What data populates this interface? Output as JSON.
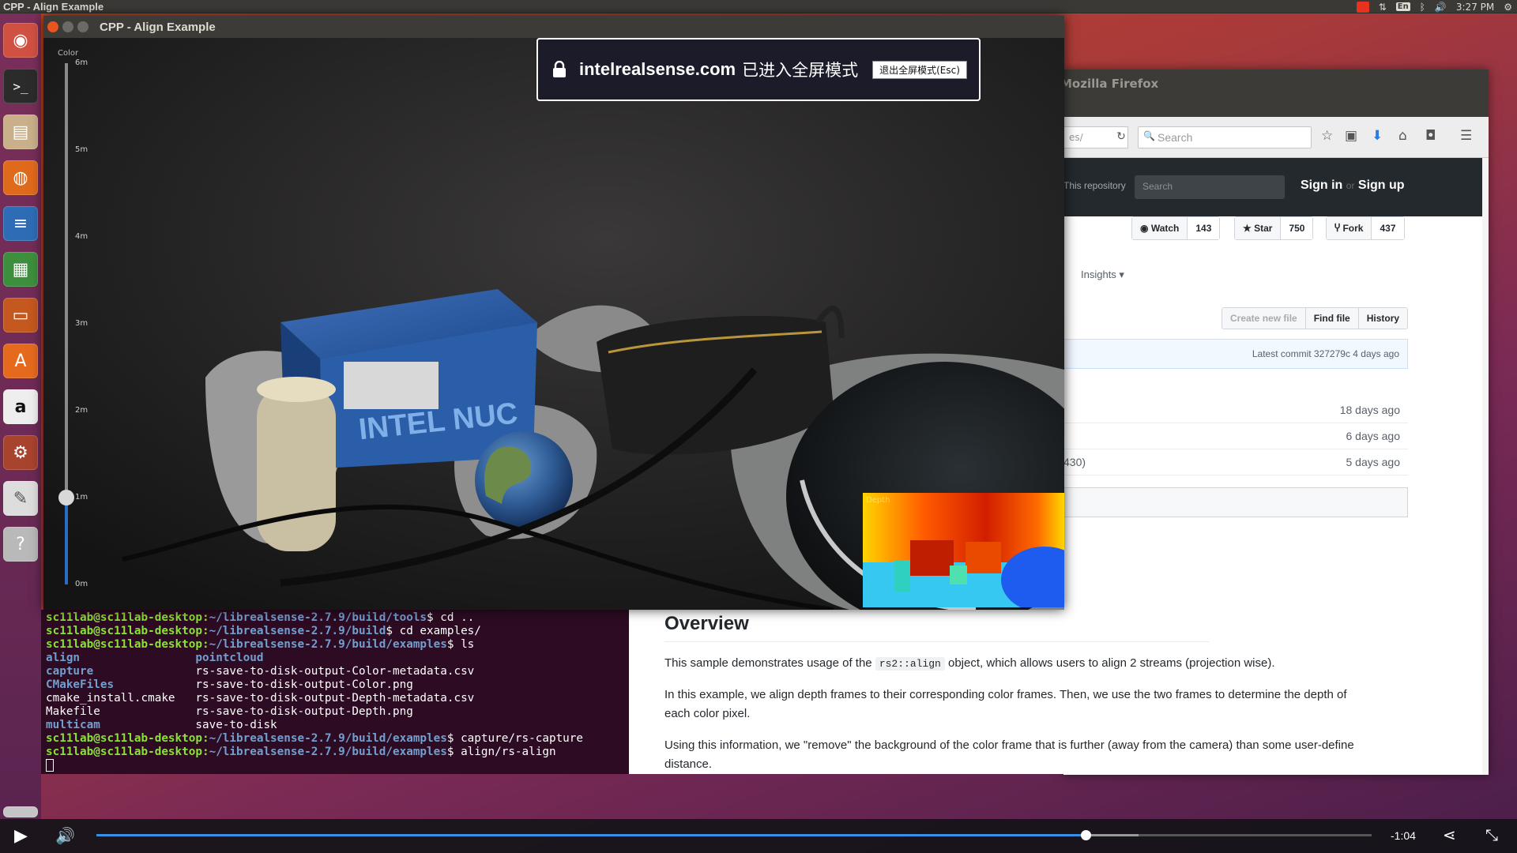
{
  "top_panel": {
    "title": "CPP - Align Example",
    "keyboard_layout": "En",
    "time": "3:27 PM"
  },
  "launcher": {
    "items": [
      "dash",
      "terminal",
      "files",
      "firefox",
      "writer",
      "calc",
      "impress",
      "software-center",
      "amazon",
      "system-settings",
      "text-editor",
      "help"
    ]
  },
  "firefox": {
    "window_title": "Mozilla Firefox",
    "url_fragment": "es/",
    "search_placeholder": "Search",
    "github": {
      "repo_label": "This repository",
      "search_placeholder": "Search",
      "sign_in": "Sign in",
      "or": "or",
      "sign_up": "Sign up",
      "watch_label": "Watch",
      "watch_count": "143",
      "star_label": "Star",
      "star_count": "750",
      "fork_label": "Fork",
      "fork_count": "437",
      "insights": "Insights ▾",
      "create_file": "Create new file",
      "find_file": "Find file",
      "history": "History",
      "latest_commit": "Latest commit 327279c 4 days ago",
      "file_rows": [
        {
          "left": "",
          "age": "18 days ago"
        },
        {
          "left": "",
          "age": "6 days ago"
        },
        {
          "left": "430)",
          "age": "5 days ago"
        }
      ]
    }
  },
  "readme": {
    "heading": "Overview",
    "p1_before": "This sample demonstrates usage of the ",
    "p1_code": "rs2::align",
    "p1_after": " object, which allows users to align 2 streams (projection wise).",
    "p2": "In this example, we align depth frames to their corresponding color frames. Then, we use the two frames to determine the depth of each color pixel.",
    "p3": "Using this information, we \"remove\" the background of the color frame that is further (away from the camera) than some user-define distance."
  },
  "terminal": {
    "lines": [
      {
        "user": "sc11lab@sc11lab-desktop",
        "path": "~/librealsense-2.7.9/build/tools",
        "cmd": "$ cd .."
      },
      {
        "user": "sc11lab@sc11lab-desktop",
        "path": "~/librealsense-2.7.9/build",
        "cmd": "$ cd examples/"
      },
      {
        "user": "sc11lab@sc11lab-desktop",
        "path": "~/librealsense-2.7.9/build/examples",
        "cmd": "$ ls"
      }
    ],
    "ls_rows": [
      [
        "align",
        "pointcloud"
      ],
      [
        "capture",
        "rs-save-to-disk-output-Color-metadata.csv"
      ],
      [
        "CMakeFiles",
        "rs-save-to-disk-output-Color.png"
      ],
      [
        "cmake_install.cmake",
        "rs-save-to-disk-output-Depth-metadata.csv"
      ],
      [
        "Makefile",
        "rs-save-to-disk-output-Depth.png"
      ],
      [
        "multicam",
        "save-to-disk"
      ]
    ],
    "lines2": [
      {
        "user": "sc11lab@sc11lab-desktop",
        "path": "~/librealsense-2.7.9/build/examples",
        "cmd": "$ capture/rs-capture"
      },
      {
        "user": "sc11lab@sc11lab-desktop",
        "path": "~/librealsense-2.7.9/build/examples",
        "cmd": "$ align/rs-align"
      }
    ]
  },
  "align_window": {
    "title": "CPP - Align Example",
    "slider_label": "Color",
    "slider_ticks": [
      "6m",
      "5m",
      "4m",
      "3m",
      "2m",
      "1m",
      "0m"
    ],
    "slider_value_m": 1.0,
    "depth_label": "Depth",
    "box_text": "INTEL NUC"
  },
  "fullscreen_notice": {
    "domain": "intelrealsense.com",
    "message": "已进入全屏模式",
    "exit_button": "退出全屏模式(Esc)"
  },
  "video_controls": {
    "time_remaining": "-1:04",
    "progress_fraction": 0.776,
    "buffer_fraction": 0.817
  }
}
